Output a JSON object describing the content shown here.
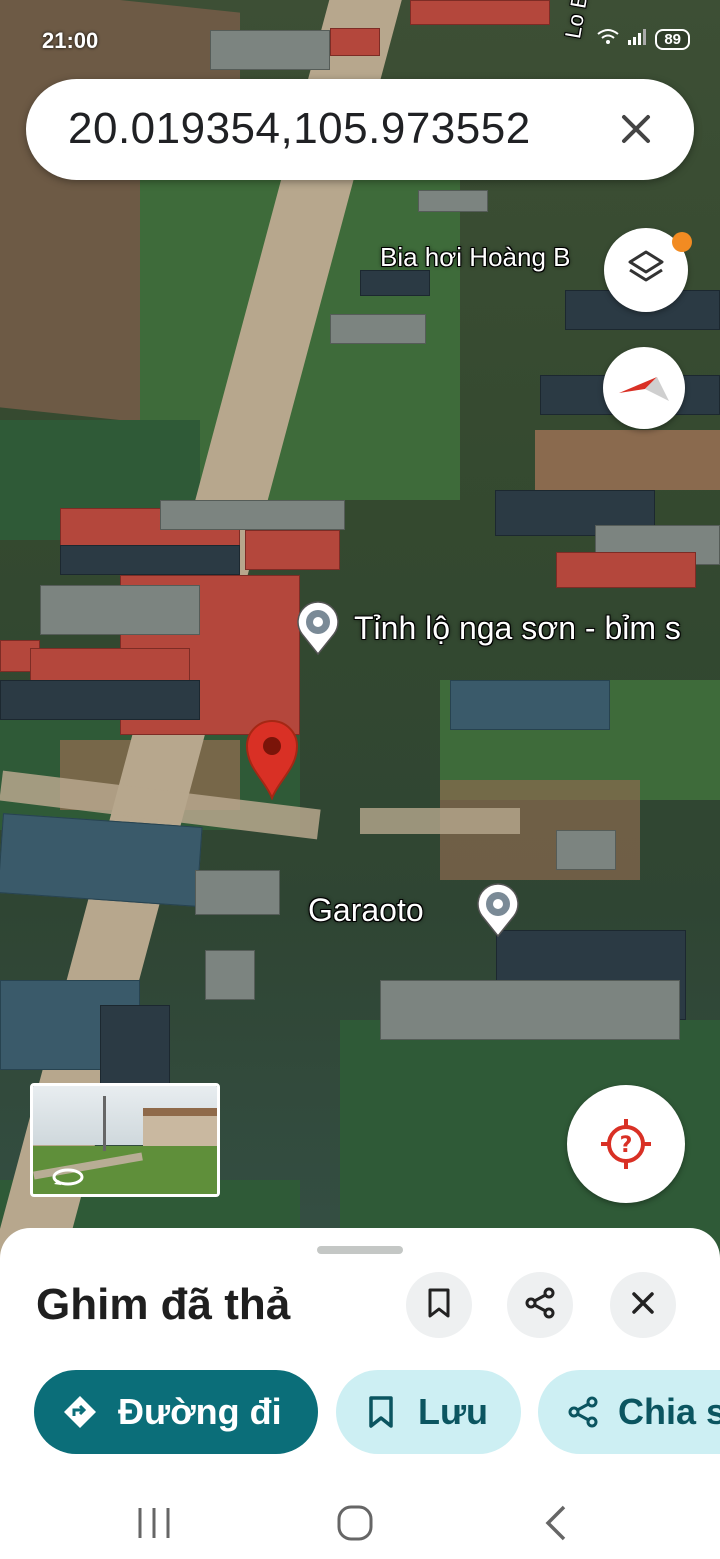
{
  "status_bar": {
    "time": "21:00",
    "battery": "89"
  },
  "search": {
    "query": "20.019354,105.973552"
  },
  "map": {
    "road_label": "Lo Bi",
    "labels": {
      "bia_hoi": "Bia hơi Hoàng B",
      "tinh_lo": "Tỉnh lộ nga sơn - bỉm s",
      "garaoto": "Garaoto"
    },
    "accent_red": "#d93025"
  },
  "sheet": {
    "title": "Ghim đã thả",
    "actions": {
      "directions": "Đường đi",
      "save": "Lưu",
      "share": "Chia s"
    }
  },
  "icons": [
    "close-icon",
    "layers-icon",
    "compass-icon",
    "my-location-icon",
    "bookmark-icon",
    "share-icon",
    "directions-icon",
    "recents-icon",
    "home-icon",
    "back-icon"
  ],
  "colors": {
    "primary_chip": "#0b6e79",
    "secondary_chip": "#cdeff3"
  }
}
